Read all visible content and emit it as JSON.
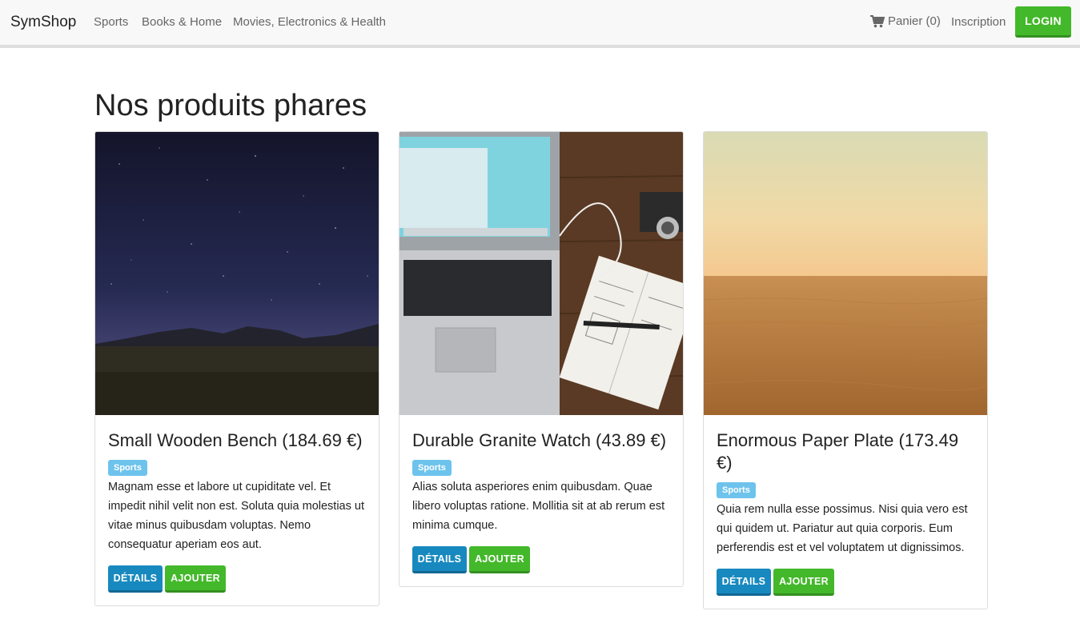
{
  "navbar": {
    "brand": "SymShop",
    "links": [
      "Sports",
      "Books & Home",
      "Movies, Electronics & Health"
    ],
    "cart_label": "Panier (0)",
    "register_label": "Inscription",
    "login_label": "LOGIN"
  },
  "main": {
    "heading": "Nos produits phares",
    "products": [
      {
        "title": "Small Wooden Bench (184.69 €)",
        "category": "Sports",
        "description": "Magnam esse et labore ut cupiditate vel. Et impedit nihil velit non est. Soluta quia molestias ut vitae minus quibusdam voluptas. Nemo consequatur aperiam eos aut.",
        "details_label": "DÉTAILS",
        "add_label": "AJOUTER"
      },
      {
        "title": "Durable Granite Watch (43.89 €)",
        "category": "Sports",
        "description": "Alias soluta asperiores enim quibusdam. Quae libero voluptas ratione. Mollitia sit at ab rerum est minima cumque.",
        "details_label": "DÉTAILS",
        "add_label": "AJOUTER"
      },
      {
        "title": "Enormous Paper Plate (173.49 €)",
        "category": "Sports",
        "description": "Quia rem nulla esse possimus. Nisi quia vero est qui quidem ut. Pariatur aut quia corporis. Eum perferendis est et vel voluptatem ut dignissimos.",
        "details_label": "DÉTAILS",
        "add_label": "AJOUTER"
      }
    ]
  },
  "colors": {
    "primary_green": "#43b82a",
    "primary_blue": "#1889bf",
    "badge_blue": "#6ec3ec"
  },
  "icons": {
    "cart": "shopping-cart-icon"
  }
}
